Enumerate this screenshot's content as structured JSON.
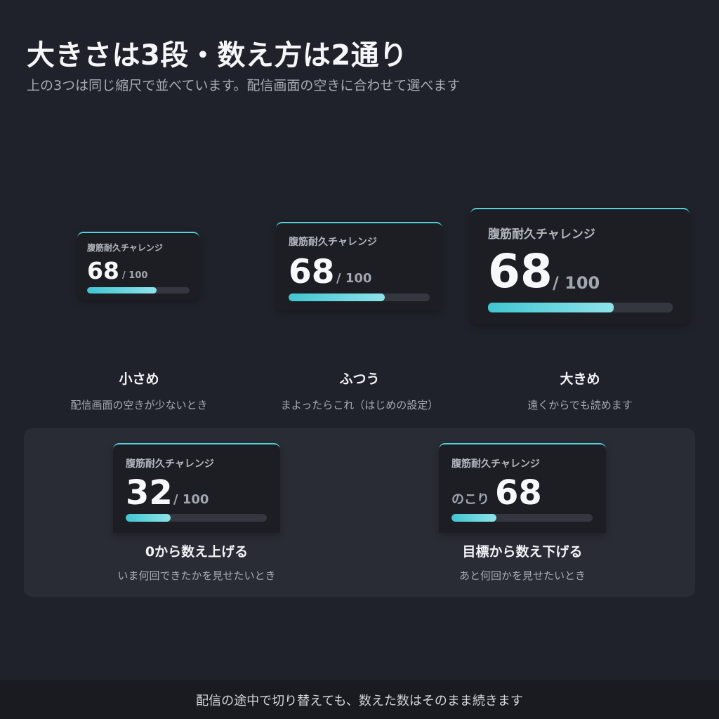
{
  "header": {
    "title": "大きさは3段・数え方は2通り",
    "subtitle": "上の3つは同じ縮尺で並べています。配信画面の空きに合わせて選べます"
  },
  "widget_label": "腹筋耐久チャレンジ",
  "sizes": [
    {
      "name": "小さめ",
      "desc": "配信画面の空きが少ないとき",
      "count": "68",
      "denom": "/ 100",
      "progress": 0.68
    },
    {
      "name": "ふつう",
      "desc": "まよったらこれ（はじめの設定）",
      "count": "68",
      "denom": "/ 100",
      "progress": 0.68
    },
    {
      "name": "大きめ",
      "desc": "遠くからでも読めます",
      "count": "68",
      "denom": "/ 100",
      "progress": 0.68
    }
  ],
  "modes": [
    {
      "name": "0から数え上げる",
      "desc": "いま何回できたかを見せたいとき",
      "count": "32",
      "denom": "/ 100",
      "progress": 0.32
    },
    {
      "name": "目標から数え下げる",
      "desc": "あと何回かを見せたいとき",
      "prefix": "のこり",
      "count": "68",
      "progress": 0.32
    }
  ],
  "footer": "配信の途中で切り替えても、数えた数はそのまま続きます",
  "colors": {
    "background": "#20222b",
    "card": "#1c1e23",
    "panel": "#2a2c35",
    "accent": "#52d2dc",
    "track": "#34373f"
  }
}
